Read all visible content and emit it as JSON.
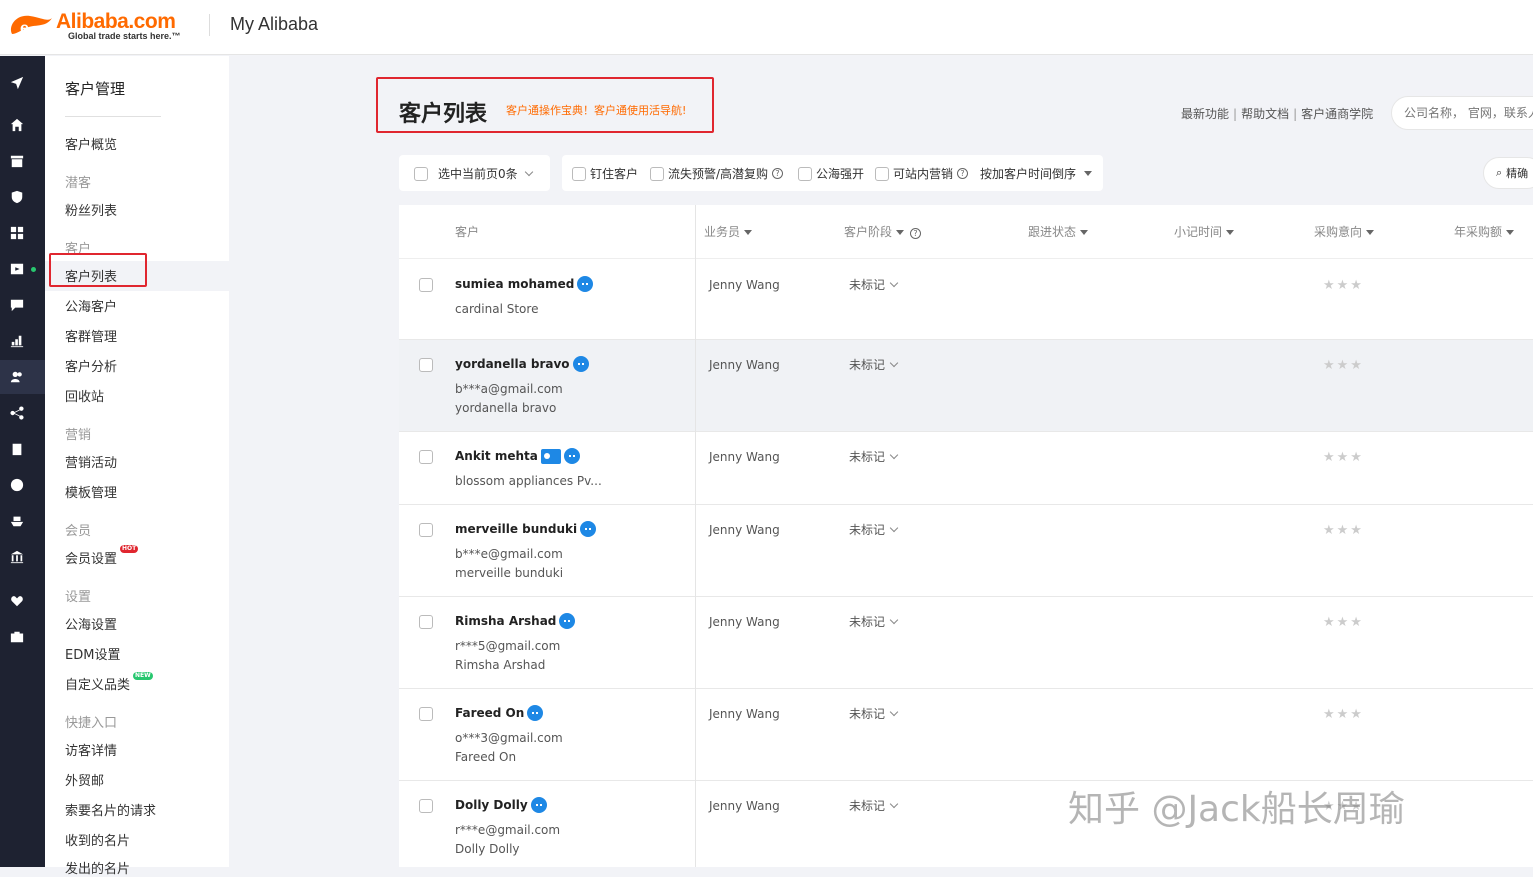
{
  "header": {
    "logo_text": "Alibaba.com",
    "logo_tagline": "Global trade starts here.™",
    "site_title": "My Alibaba"
  },
  "rail": {
    "icons": [
      "send-icon",
      "home-icon",
      "store-icon",
      "shield-icon",
      "grid-icon",
      "video-icon",
      "chat-icon",
      "bar-chart-icon",
      "customers-icon",
      "share-icon",
      "clipboard-icon",
      "globe-icon",
      "ship-icon",
      "bank-icon",
      "heart-icon",
      "briefcase-icon"
    ]
  },
  "sidenav": {
    "heading": "客户管理",
    "overview": "客户概览",
    "group_leads": "潜客",
    "fans": "粉丝列表",
    "group_customers": "客户",
    "customer_list": "客户列表",
    "public_customers": "公海客户",
    "group_mgmt": "客群管理",
    "customer_analysis": "客户分析",
    "recycle_bin": "回收站",
    "group_marketing": "营销",
    "marketing_activities": "营销活动",
    "template_mgmt": "模板管理",
    "group_members": "会员",
    "member_settings": "会员设置",
    "hot_badge": "HOT",
    "group_settings": "设置",
    "public_settings": "公海设置",
    "edm_settings": "EDM设置",
    "custom_category": "自定义品类",
    "new_badge": "NEW",
    "group_shortcuts": "快捷入口",
    "visitor_details": "访客详情",
    "trade_mail": "外贸邮",
    "card_requests": "索要名片的请求",
    "received_cards": "收到的名片",
    "sent_cards": "发出的名片"
  },
  "main": {
    "title": "客户列表",
    "subtitle": "客户通操作宝典！客户通使用活导航!",
    "links": [
      "最新功能",
      "帮助文档",
      "客户通商学院"
    ],
    "search_placeholder": "公司名称， 官网，联系人",
    "toolbar": {
      "select_page": "选中当前页0条",
      "pinned": "钉住客户",
      "churn_warning": "流失预警/高潜复购",
      "public_force": "公海强开",
      "marketable": "可站内营销",
      "sort": "按加客户时间倒序",
      "precise": "精确"
    },
    "columns": {
      "customer": "客户",
      "salesperson": "业务员",
      "stage": "客户阶段",
      "follow_status": "跟进状态",
      "note_time": "小记时间",
      "purchase_intent": "采购意向",
      "annual_purchase": "年采购额"
    },
    "rows": [
      {
        "name": "sumiea mohamed",
        "line1": "cardinal Store",
        "line2": "",
        "sales": "Jenny Wang",
        "stage": "未标记",
        "stars": "★★★"
      },
      {
        "name": "yordanella bravo",
        "line1": "b***a@gmail.com",
        "line2": "yordanella bravo",
        "sales": "Jenny Wang",
        "stage": "未标记",
        "stars": "★★★"
      },
      {
        "name": "Ankit mehta",
        "line1": "blossom appliances Pv...",
        "line2": "",
        "sales": "Jenny Wang",
        "stage": "未标记",
        "stars": "★★★"
      },
      {
        "name": "merveille bunduki",
        "line1": "b***e@gmail.com",
        "line2": "merveille bunduki",
        "sales": "Jenny Wang",
        "stage": "未标记",
        "stars": "★★★"
      },
      {
        "name": "Rimsha Arshad",
        "line1": "r***5@gmail.com",
        "line2": "Rimsha Arshad",
        "sales": "Jenny Wang",
        "stage": "未标记",
        "stars": "★★★"
      },
      {
        "name": "Fareed On",
        "line1": "o***3@gmail.com",
        "line2": "Fareed On",
        "sales": "Jenny Wang",
        "stage": "未标记",
        "stars": "★★★"
      },
      {
        "name": "Dolly Dolly",
        "line1": "r***e@gmail.com",
        "line2": "Dolly Dolly",
        "sales": "Jenny Wang",
        "stage": "未标记",
        "stars": "★★★"
      }
    ]
  },
  "watermark": "知乎 @Jack船长周瑜",
  "colors": {
    "brand": "#ff6a00",
    "highlight_box": "#e0262f",
    "rail": "#1e2231",
    "chat_icon": "#1e88e5"
  }
}
